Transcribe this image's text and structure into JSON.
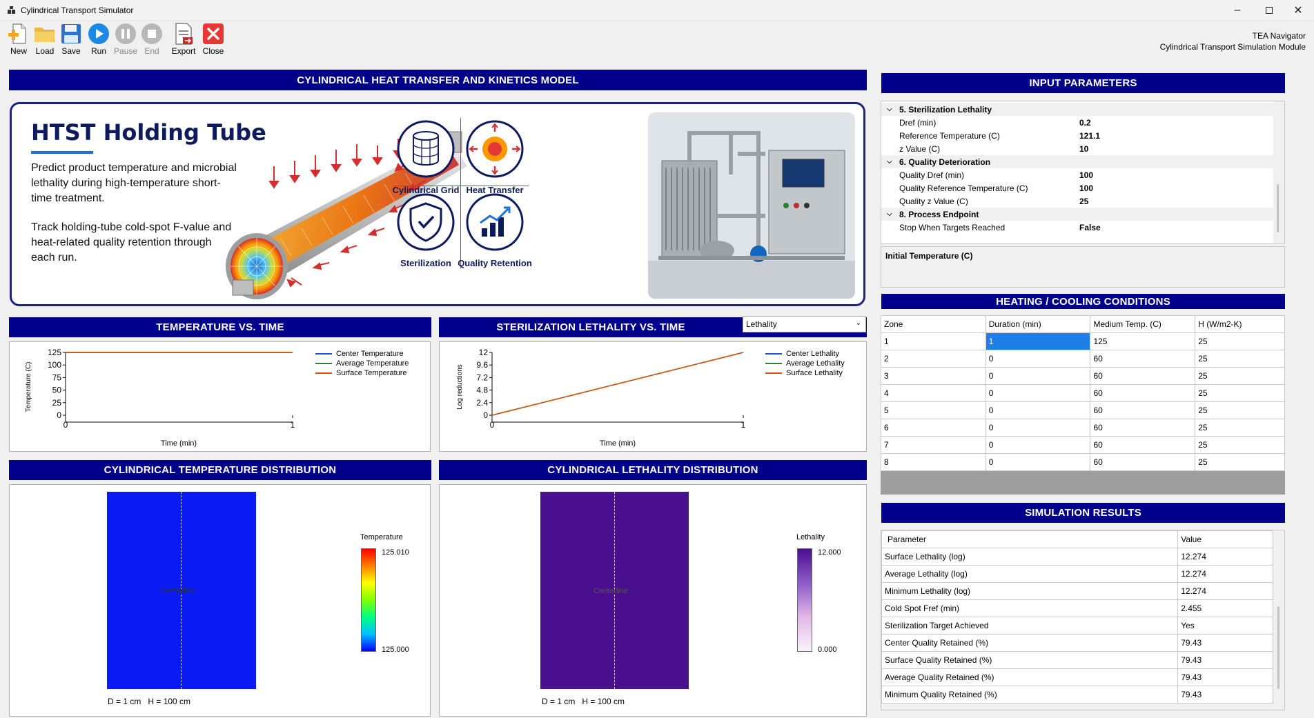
{
  "window": {
    "title": "Cylindrical Transport Simulator"
  },
  "toolbar": {
    "buttons": [
      {
        "label": "New"
      },
      {
        "label": "Load"
      },
      {
        "label": "Save"
      },
      {
        "label": "Run"
      },
      {
        "label": "Pause"
      },
      {
        "label": "End"
      },
      {
        "label": "Export"
      },
      {
        "label": "Close"
      }
    ],
    "brand_line1": "TEA Navigator",
    "brand_line2": "Cylindrical Transport Simulation Module"
  },
  "model_header": "CYLINDRICAL HEAT TRANSFER AND KINETICS MODEL",
  "hero": {
    "title": "HTST Holding Tube",
    "desc1": "Predict product temperature and microbial lethality during high-temperature short-time treatment.",
    "desc2": "Track holding-tube cold-spot F-value and heat-related quality retention through each run.",
    "features": [
      "Cylindrical Grid",
      "Heat Transfer",
      "Sterilization",
      "Quality Retention"
    ]
  },
  "temp_chart": {
    "header": "TEMPERATURE VS. TIME",
    "ylabel": "Temperature (C)",
    "xlabel": "Time (min)",
    "yticks": [
      "125",
      "100",
      "75",
      "50",
      "25",
      "0"
    ],
    "xticks": [
      "0",
      "1"
    ],
    "legend": [
      {
        "name": "Center Temperature",
        "color": "#1f4fe0"
      },
      {
        "name": "Average Temperature",
        "color": "#2e7d32"
      },
      {
        "name": "Surface Temperature",
        "color": "#e65100"
      }
    ]
  },
  "leth_chart": {
    "header": "STERILIZATION LETHALITY VS. TIME",
    "selector": "Lethality",
    "ylabel": "Log reductions",
    "xlabel": "Time (min)",
    "yticks": [
      "12",
      "9.6",
      "7.2",
      "4.8",
      "2.4",
      "0"
    ],
    "xticks": [
      "0",
      "1"
    ],
    "legend": [
      {
        "name": "Center Lethality",
        "color": "#1f4fe0"
      },
      {
        "name": "Average Lethality",
        "color": "#2e7d32"
      },
      {
        "name": "Surface Lethality",
        "color": "#e65100"
      }
    ]
  },
  "chart_data": [
    {
      "type": "line",
      "x": [
        0,
        1
      ],
      "series": [
        {
          "name": "Center Temperature",
          "values": [
            125,
            125
          ]
        },
        {
          "name": "Average Temperature",
          "values": [
            125,
            125
          ]
        },
        {
          "name": "Surface Temperature",
          "values": [
            125,
            125
          ]
        }
      ],
      "ylabel": "Temperature (C)",
      "xlabel": "Time (min)",
      "xlim": [
        0,
        1
      ],
      "ylim": [
        0,
        125
      ]
    },
    {
      "type": "line",
      "x": [
        0,
        1
      ],
      "series": [
        {
          "name": "Center Lethality",
          "values": [
            0,
            12
          ]
        },
        {
          "name": "Average Lethality",
          "values": [
            0,
            12
          ]
        },
        {
          "name": "Surface Lethality",
          "values": [
            0,
            12
          ]
        }
      ],
      "ylabel": "Log reductions",
      "xlabel": "Time (min)",
      "xlim": [
        0,
        1
      ],
      "ylim": [
        0,
        12
      ]
    }
  ],
  "temp_dist": {
    "header": "CYLINDRICAL TEMPERATURE DISTRIBUTION",
    "center_label": "Centerline",
    "dims": "D = 1 cm   H = 100 cm",
    "scale_title": "Temperature",
    "scale_max": "125.010",
    "scale_min": "125.000",
    "fill_color": "#0a1af5"
  },
  "leth_dist": {
    "header": "CYLINDRICAL LETHALITY DISTRIBUTION",
    "center_label": "Centerline",
    "dims": "D = 1 cm   H = 100 cm",
    "scale_title": "Lethality",
    "scale_max": "12.000",
    "scale_min": "0.000",
    "fill_color": "#4a0f8f"
  },
  "input_params": {
    "header": "INPUT PARAMETERS",
    "rows": [
      {
        "kind": "cat",
        "name": "5. Sterilization Lethality",
        "value": ""
      },
      {
        "kind": "item",
        "name": "Dref (min)",
        "value": "0.2"
      },
      {
        "kind": "item",
        "name": "Reference Temperature (C)",
        "value": "121.1"
      },
      {
        "kind": "item",
        "name": "z Value (C)",
        "value": "10"
      },
      {
        "kind": "cat",
        "name": "6. Quality Deterioration",
        "value": ""
      },
      {
        "kind": "item",
        "name": "Quality Dref (min)",
        "value": "100"
      },
      {
        "kind": "item",
        "name": "Quality Reference Temperature (C)",
        "value": "100"
      },
      {
        "kind": "item",
        "name": "Quality z Value (C)",
        "value": "25"
      },
      {
        "kind": "cat",
        "name": "8. Process Endpoint",
        "value": ""
      },
      {
        "kind": "item",
        "name": "Stop When Targets Reached",
        "value": "False"
      }
    ],
    "description_title": "Initial Temperature (C)"
  },
  "heating": {
    "header": "HEATING / COOLING CONDITIONS",
    "columns": [
      "Zone",
      "Duration (min)",
      "Medium Temp. (C)",
      "H (W/m2-K)"
    ],
    "rows": [
      [
        "1",
        "1",
        "125",
        "25"
      ],
      [
        "2",
        "0",
        "60",
        "25"
      ],
      [
        "3",
        "0",
        "60",
        "25"
      ],
      [
        "4",
        "0",
        "60",
        "25"
      ],
      [
        "5",
        "0",
        "60",
        "25"
      ],
      [
        "6",
        "0",
        "60",
        "25"
      ],
      [
        "7",
        "0",
        "60",
        "25"
      ],
      [
        "8",
        "0",
        "60",
        "25"
      ]
    ]
  },
  "results": {
    "header": "SIMULATION RESULTS",
    "columns": [
      "Parameter",
      "Value"
    ],
    "rows": [
      [
        "Surface Lethality (log)",
        "12.274"
      ],
      [
        "Average Lethality (log)",
        "12.274"
      ],
      [
        "Minimum Lethality (log)",
        "12.274"
      ],
      [
        "Cold Spot Fref (min)",
        "2.455"
      ],
      [
        "Sterilization Target Achieved",
        "Yes"
      ],
      [
        "Center Quality Retained (%)",
        "79.43"
      ],
      [
        "Surface Quality Retained (%)",
        "79.43"
      ],
      [
        "Average Quality Retained (%)",
        "79.43"
      ],
      [
        "Minimum Quality Retained (%)",
        "79.43"
      ]
    ]
  }
}
